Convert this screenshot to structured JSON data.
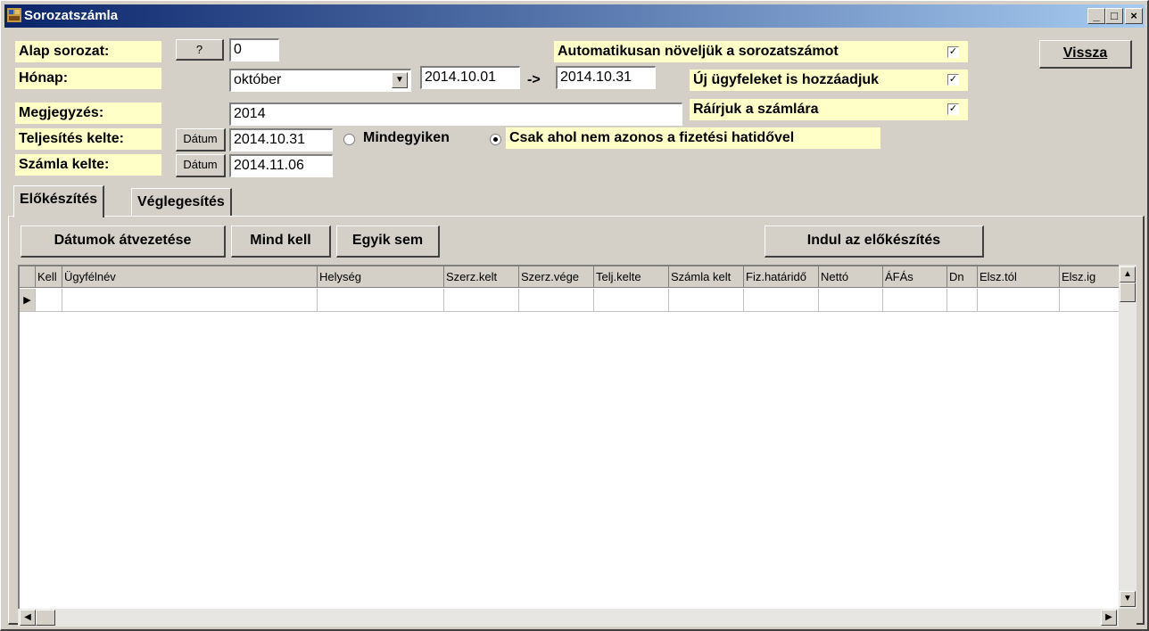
{
  "window": {
    "title": "Sorozatszámla",
    "minimize": "_",
    "maximize": "□",
    "close": "×"
  },
  "form": {
    "alap_label": "Alap sorozat:",
    "alap_button": "?",
    "alap_value": "0",
    "honap_label": "Hónap:",
    "honap_value": "október",
    "date_from": "2014.10.01",
    "arrow": "->",
    "date_to": "2014.10.31",
    "megjegyzes_label": "Megjegyzés:",
    "megjegyzes_value": "2014",
    "teljesites_label": "Teljesítés kelte:",
    "teljesites_button": "Dátum",
    "teljesites_value": "2014.10.31",
    "szamla_label": "Számla kelte:",
    "szamla_button": "Dátum",
    "szamla_value": "2014.11.06",
    "radio_all": "Mindegyiken",
    "radio_diff": "Csak ahol nem azonos a fizetési hatidővel",
    "opt_auto": "Automatikusan növeljük a sorozatszámot",
    "opt_uj": "Új ügyfeleket is hozzáadjuk",
    "opt_rairjuk": "Ráírjuk a számlára",
    "check_mark": "✓",
    "vissza": "Vissza"
  },
  "tabs": {
    "prepare": "Előkészítés",
    "finalize": "Véglegesítés"
  },
  "toolbar": {
    "datumok": "Dátumok átvezetése",
    "mind": "Mind kell",
    "egyik": "Egyik sem",
    "indul": "Indul az előkészítés"
  },
  "grid": {
    "columns": [
      "Kell",
      "Ügyfélnév",
      "Helység",
      "Szerz.kelt",
      "Szerz.vége",
      "Telj.kelte",
      "Számla kelt",
      "Fiz.határidő",
      "Nettó",
      "ÁFÁs",
      "Dn",
      "Elsz.tól",
      "Elsz.ig"
    ],
    "row_pointer": "▶"
  },
  "scroll": {
    "up": "▲",
    "down": "▼",
    "left": "◀",
    "right": "▶"
  }
}
